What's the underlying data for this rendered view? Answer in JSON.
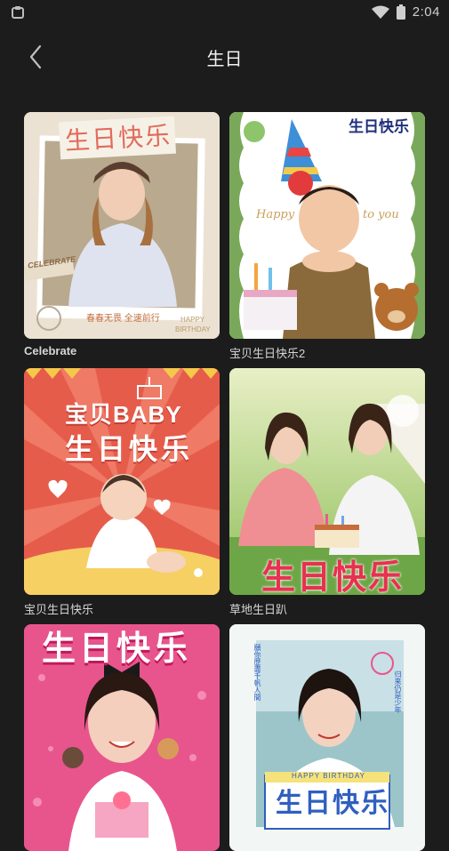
{
  "status_bar": {
    "time": "2:04"
  },
  "header": {
    "title": "生日"
  },
  "templates": [
    {
      "label": "Celebrate",
      "thumb_texts": {
        "main": "生日快乐",
        "tag": "CELEBRATE",
        "slogan": "春春无畏 全速前行",
        "happy": "HAPPY",
        "birthday": "BIRTHDAY"
      }
    },
    {
      "label": "宝贝生日快乐2",
      "thumb_texts": {
        "banner": "生日快乐",
        "happy": "Happy",
        "to_you": "to you"
      }
    },
    {
      "label": "宝贝生日快乐",
      "thumb_texts": {
        "line1": "宝贝BABY",
        "line2": "生日快乐"
      }
    },
    {
      "label": "草地生日趴",
      "thumb_texts": {
        "main": "生日快乐"
      }
    },
    {
      "label": "",
      "thumb_texts": {
        "main": "生日快乐"
      }
    },
    {
      "label": "",
      "thumb_texts": {
        "vertical1": "願你歷盡千帆人間",
        "vertical2": "归来仍是少年",
        "happy": "HAPPY BIRTHDAY",
        "main": "生日快乐"
      }
    }
  ]
}
